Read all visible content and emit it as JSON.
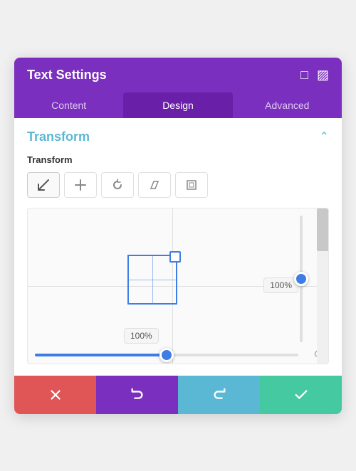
{
  "header": {
    "title": "Text Settings",
    "icon1": "⊞",
    "icon2": "▤"
  },
  "tabs": [
    {
      "label": "Content",
      "active": false
    },
    {
      "label": "Design",
      "active": true
    },
    {
      "label": "Advanced",
      "active": false
    }
  ],
  "section": {
    "title": "Transform"
  },
  "transform": {
    "label": "Transform",
    "buttons": [
      {
        "icon": "↖",
        "active": true
      },
      {
        "icon": "+",
        "active": false
      },
      {
        "icon": "↺",
        "active": false
      },
      {
        "icon": "◇",
        "active": false
      },
      {
        "icon": "⊞",
        "active": false
      }
    ]
  },
  "sliders": {
    "horizontal": {
      "value": "100%",
      "percent": 50
    },
    "vertical": {
      "value": "100%",
      "percent": 50
    }
  },
  "toolbar": {
    "cancel_icon": "✕",
    "undo_icon": "↺",
    "redo_icon": "↻",
    "confirm_icon": "✓"
  }
}
